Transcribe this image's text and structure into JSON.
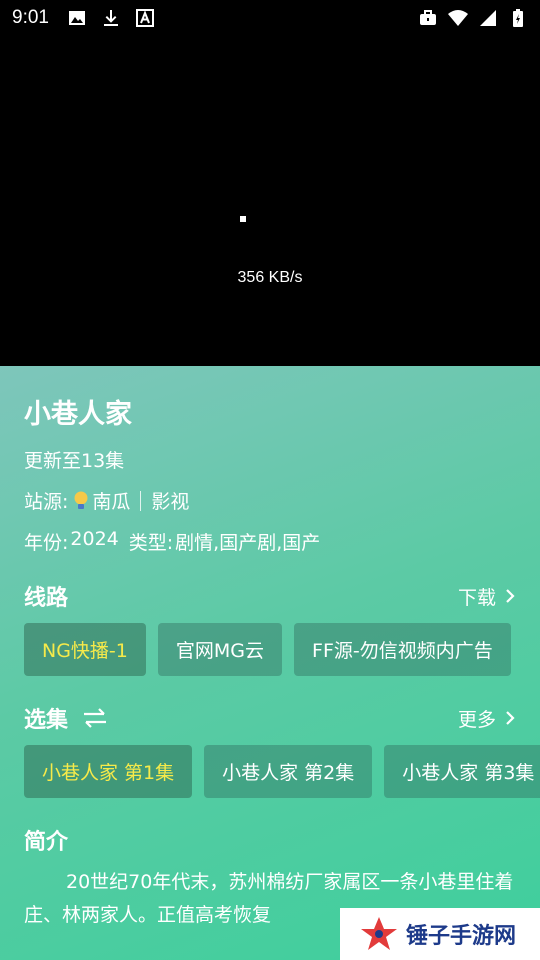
{
  "status_bar": {
    "time": "9:01",
    "left_icons": [
      "image-icon",
      "download-icon",
      "a-icon"
    ],
    "right_icons": [
      "briefcase-icon",
      "wifi-icon",
      "signal-icon",
      "battery-icon"
    ]
  },
  "player": {
    "speed": "356 KB/s"
  },
  "detail": {
    "title": "小巷人家",
    "update": "更新至13集",
    "source_label": "站源:",
    "source_name": "南瓜",
    "source_type": "影视",
    "year_label": "年份:",
    "year": "2024",
    "genre_label": "类型:",
    "genre": "剧情,国产剧,国产",
    "accent_color": "#f6ea4a"
  },
  "lines": {
    "title": "线路",
    "link": "下载",
    "items": [
      {
        "label": "NG快播-1",
        "active": true
      },
      {
        "label": "官网MG云",
        "active": false
      },
      {
        "label": "FF源-勿信视频内广告",
        "active": false
      }
    ]
  },
  "episodes": {
    "title": "选集",
    "link": "更多",
    "items": [
      {
        "label": "小巷人家 第1集",
        "active": true
      },
      {
        "label": "小巷人家 第2集",
        "active": false
      },
      {
        "label": "小巷人家 第3集",
        "active": false
      }
    ]
  },
  "intro": {
    "title": "简介",
    "text": "20世纪70年代末，苏州棉纺厂家属区一条小巷里住着庄、林两家人。正值高考恢复"
  },
  "watermark": {
    "text": "锤子手游网"
  }
}
